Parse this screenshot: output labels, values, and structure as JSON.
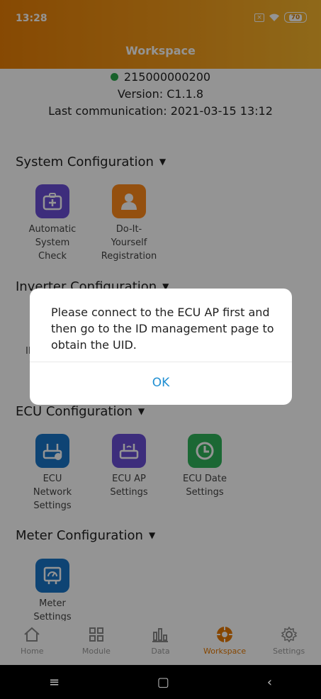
{
  "status_bar": {
    "time": "13:28",
    "battery": "70"
  },
  "header": {
    "title": "Workspace"
  },
  "device": {
    "id": "215000000200",
    "version": "Version: C1.1.8",
    "last_comm": "Last communication: 2021-03-15 13:12"
  },
  "sections": {
    "system": {
      "title": "System Configuration",
      "items": [
        {
          "label": "Automatic System Check"
        },
        {
          "label": "Do-It-Yourself Registration"
        }
      ]
    },
    "inverter": {
      "title": "Inverter Configuration",
      "item_label": "ID"
    },
    "ecu": {
      "title": "ECU Configuration",
      "items": [
        {
          "label": "ECU Network Settings"
        },
        {
          "label": "ECU AP Settings"
        },
        {
          "label": "ECU Date Settings"
        }
      ]
    },
    "meter": {
      "title": "Meter Configuration",
      "items": [
        {
          "label": "Meter Settings"
        }
      ]
    }
  },
  "dialog": {
    "message": "Please connect to the ECU AP first and then go to the ID management page to obtain the UID.",
    "ok": "OK"
  },
  "bottom_nav": [
    {
      "label": "Home",
      "icon": "home-icon"
    },
    {
      "label": "Module",
      "icon": "module-icon"
    },
    {
      "label": "Data",
      "icon": "data-icon"
    },
    {
      "label": "Workspace",
      "icon": "workspace-icon",
      "active": true
    },
    {
      "label": "Settings",
      "icon": "settings-icon"
    }
  ],
  "android_nav": {
    "menu": "≡",
    "home": "▢",
    "back": "‹"
  },
  "colors": {
    "accent": "#e77900",
    "dialog_button": "#1f8fd2",
    "status_online": "#2aa84a"
  }
}
